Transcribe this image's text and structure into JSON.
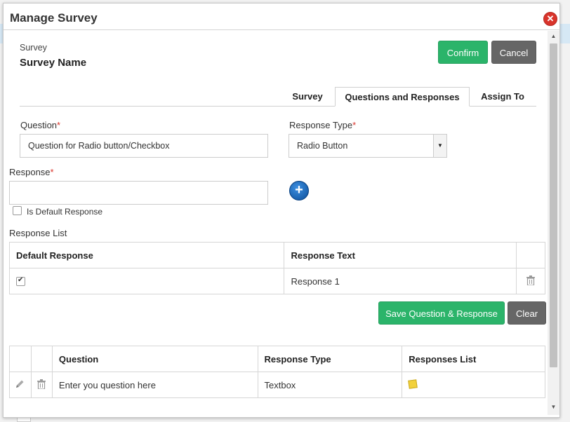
{
  "dialog": {
    "title": "Manage Survey",
    "close_icon": "close-icon"
  },
  "survey": {
    "label": "Survey",
    "name": "Survey Name"
  },
  "actions": {
    "confirm_label": "Confirm",
    "cancel_label": "Cancel",
    "confirm_color": "#2bb46a",
    "cancel_color": "#666666"
  },
  "tabs": [
    {
      "label": "Survey",
      "active": false
    },
    {
      "label": "Questions and Responses",
      "active": true
    },
    {
      "label": "Assign To",
      "active": false
    }
  ],
  "form": {
    "question_label": "Question",
    "question_value": "Question for Radio button/Checkbox",
    "response_type_label": "Response Type",
    "response_type_value": "Radio Button",
    "response_label": "Response",
    "response_value": "",
    "required_mark": "*",
    "default_response_label": "Is Default Response",
    "default_response_checked": false,
    "add_icon": "plus-icon"
  },
  "response_list": {
    "title": "Response List",
    "columns": [
      "Default Response",
      "Response Text",
      ""
    ],
    "rows": [
      {
        "default": true,
        "text": "Response 1",
        "delete_icon": "trash-icon"
      }
    ]
  },
  "save_actions": {
    "save_label": "Save Question & Response",
    "clear_label": "Clear"
  },
  "questions_table": {
    "columns": [
      "",
      "",
      "Question",
      "Response Type",
      "Responses List"
    ],
    "rows": [
      {
        "edit_icon": "pencil-icon",
        "delete_icon": "trash-icon",
        "question": "Enter you question here",
        "response_type": "Textbox",
        "responses_icon": "note-icon"
      }
    ]
  }
}
